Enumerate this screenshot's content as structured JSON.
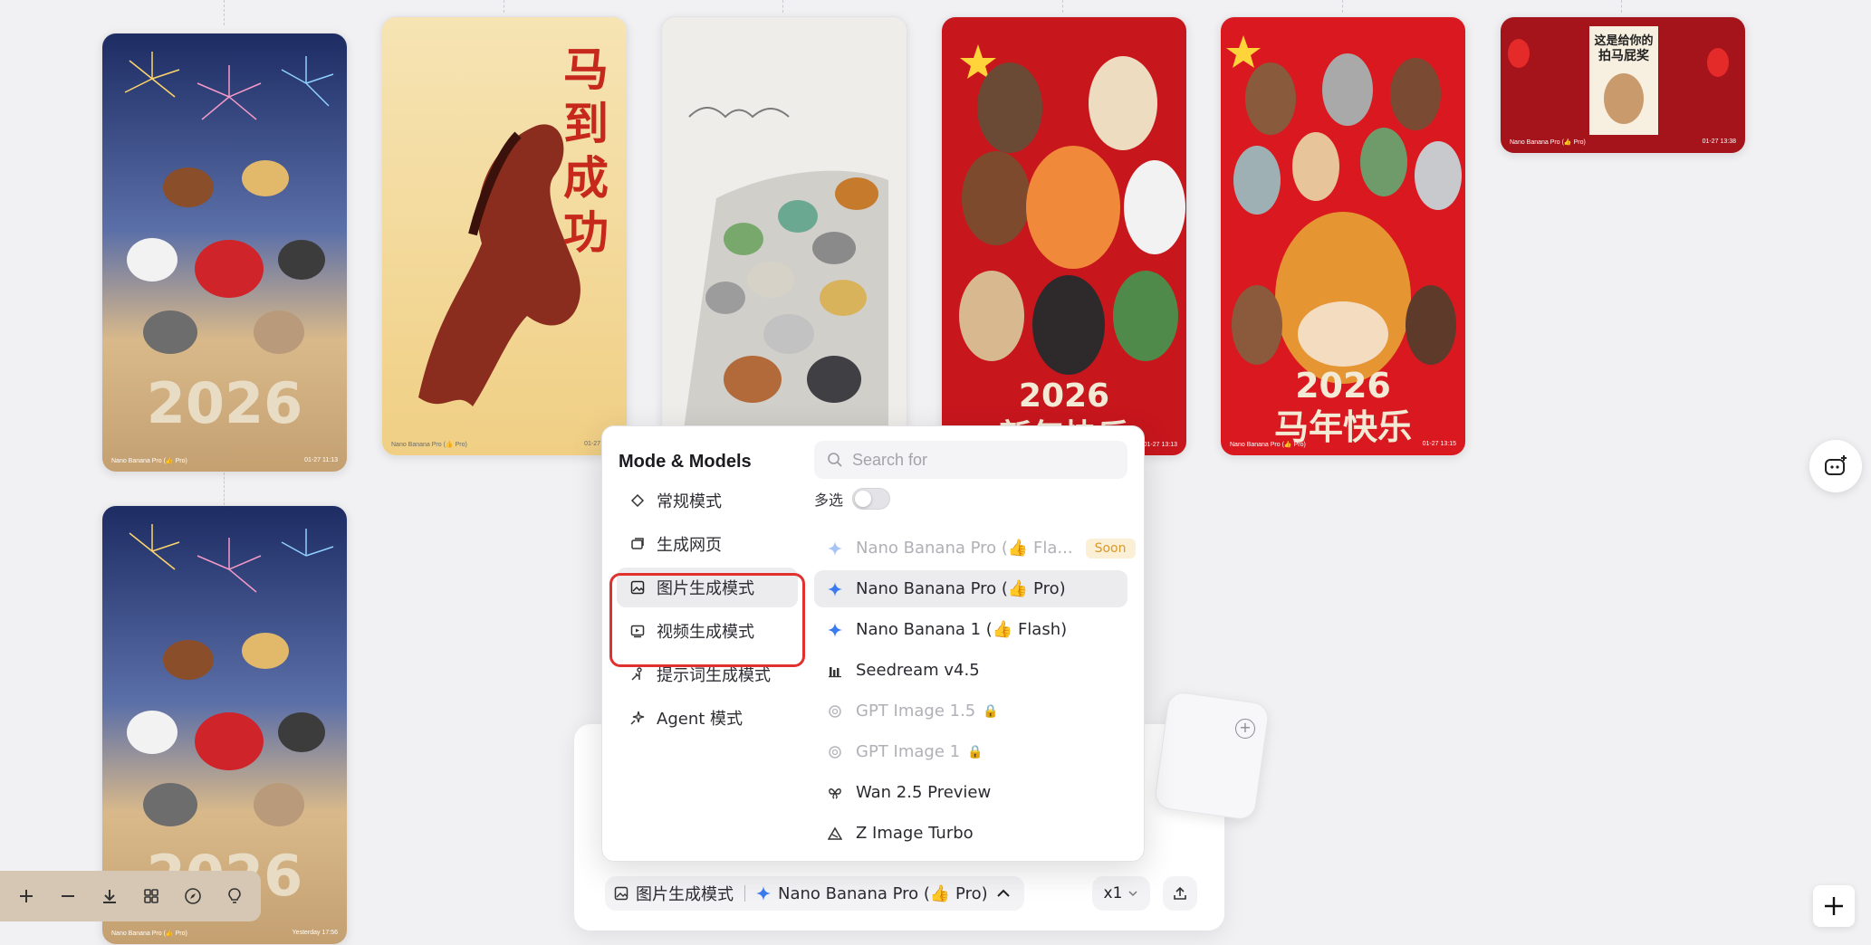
{
  "gallery": {
    "cards": [
      {
        "id": "fireworks-2026",
        "caption_model": "Nano Banana Pro (👍 Pro)",
        "caption_time": "01-27 11:13",
        "art_text": "2026"
      },
      {
        "id": "galloping-horse",
        "caption_model": "Nano Banana Pro (👍 Pro)",
        "caption_time": "01-27 11:13",
        "art_text": "马到成功"
      },
      {
        "id": "ink-horses",
        "caption_model": "",
        "caption_time": "",
        "art_text": ""
      },
      {
        "id": "cartoon-horses-1",
        "caption_model": "",
        "caption_time": "01-27 13:13",
        "art_text": "2026 新年快乐"
      },
      {
        "id": "cartoon-horses-2",
        "caption_model": "Nano Banana Pro (👍 Pro)",
        "caption_time": "01-27 13:15",
        "art_text": "2026 马年快乐"
      },
      {
        "id": "red-banner",
        "caption_model": "Nano Banana Pro (👍 Pro)",
        "caption_time": "01-27 13:38",
        "art_text": "这是给你的拍马屁奖"
      },
      {
        "id": "fireworks-copy",
        "caption_model": "Nano Banana Pro (👍 Pro)",
        "caption_time": "Yesterday 17:56",
        "art_text": "2026"
      }
    ]
  },
  "popover": {
    "title": "Mode & Models",
    "search_placeholder": "Search for",
    "multiselect_label": "多选",
    "multiselect_on": false,
    "modes": [
      {
        "label": "常规模式",
        "icon": "diamond-icon",
        "selected": false
      },
      {
        "label": "生成网页",
        "icon": "webpage-icon",
        "selected": false
      },
      {
        "label": "图片生成模式",
        "icon": "image-icon",
        "selected": true
      },
      {
        "label": "视频生成模式",
        "icon": "video-icon",
        "selected": false
      },
      {
        "label": "提示词生成模式",
        "icon": "prompt-icon",
        "selected": false
      },
      {
        "label": "Agent 模式",
        "icon": "agent-icon",
        "selected": false
      }
    ],
    "models": [
      {
        "label": "Nano Banana Pro (👍 Fla...",
        "icon": "gemini-icon",
        "badge": "Soon",
        "disabled": true,
        "selected": false
      },
      {
        "label": "Nano Banana Pro (👍 Pro)",
        "icon": "gemini-icon",
        "badge": "",
        "disabled": false,
        "selected": true
      },
      {
        "label": "Nano Banana 1 (👍 Flash)",
        "icon": "gemini-icon",
        "badge": "",
        "disabled": false,
        "selected": false
      },
      {
        "label": "Seedream v4.5",
        "icon": "seedream-icon",
        "badge": "",
        "disabled": false,
        "selected": false
      },
      {
        "label": "GPT Image 1.5",
        "icon": "openai-icon",
        "badge": "",
        "disabled": true,
        "locked": true,
        "selected": false
      },
      {
        "label": "GPT Image 1",
        "icon": "openai-icon",
        "badge": "",
        "disabled": true,
        "locked": true,
        "selected": false
      },
      {
        "label": "Wan 2.5 Preview",
        "icon": "wan-icon",
        "badge": "",
        "disabled": false,
        "selected": false
      },
      {
        "label": "Z Image Turbo",
        "icon": "zimage-icon",
        "badge": "",
        "disabled": false,
        "selected": false
      }
    ]
  },
  "composer": {
    "mode_label": "图片生成模式",
    "model_label": "Nano Banana Pro (👍 Pro)",
    "count_label": "x1"
  },
  "colors": {
    "highlight": "#e0312f",
    "soon_badge_bg": "#fbefd6",
    "soon_badge_fg": "#d79a2b",
    "toolbar_bg": "#d6c7b4"
  }
}
